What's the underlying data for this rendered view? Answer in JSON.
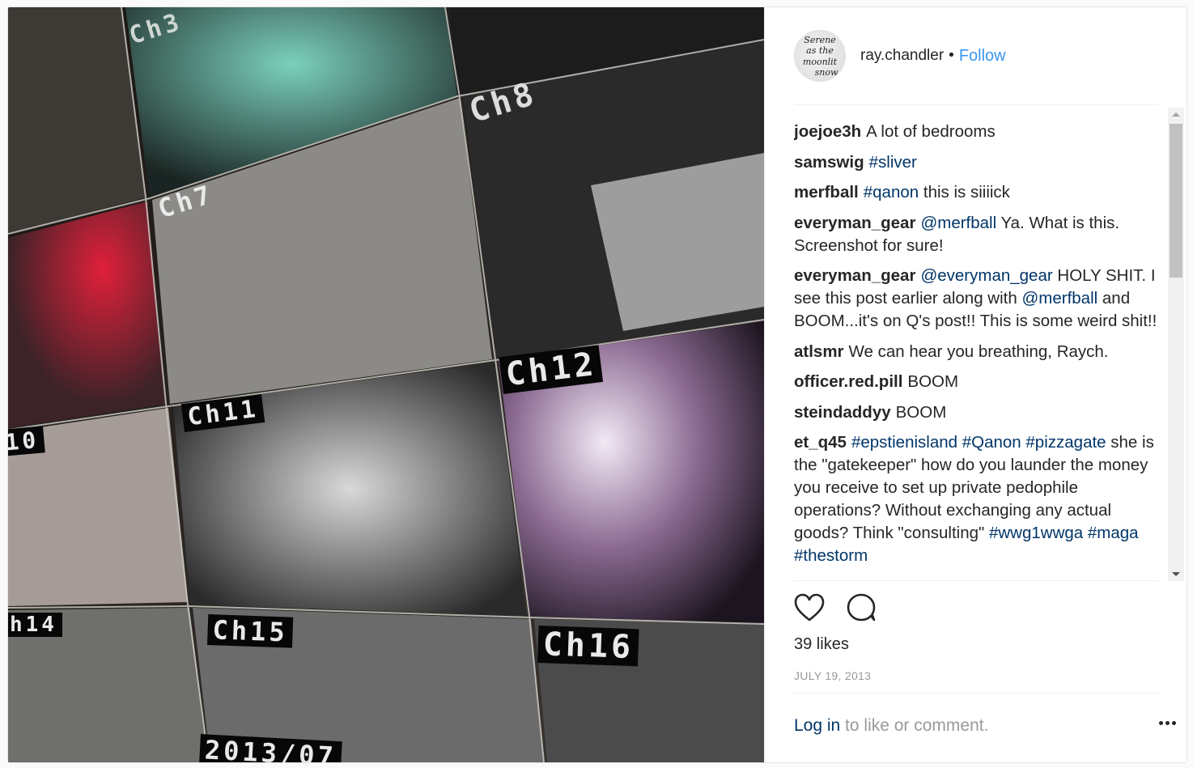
{
  "post": {
    "photo": {
      "description": "Photo of a CCTV multi-camera monitor wall",
      "channel_labels": [
        "Ch3",
        "Ch7",
        "Ch8",
        "10",
        "Ch11",
        "Ch12",
        "h14",
        "Ch15",
        "Ch16",
        "2013/07"
      ]
    },
    "header": {
      "avatar_text": [
        "Serene",
        "as the",
        "moonlit",
        "snow"
      ],
      "username": "ray.chandler",
      "separator": "•",
      "follow_label": "Follow"
    },
    "comments": [
      {
        "user": "joejoe3h",
        "parts": [
          {
            "type": "text",
            "value": "A lot of bedrooms"
          }
        ]
      },
      {
        "user": "samswig",
        "parts": [
          {
            "type": "tag",
            "value": "#sliver"
          }
        ]
      },
      {
        "user": "merfball",
        "parts": [
          {
            "type": "tag",
            "value": "#qanon"
          },
          {
            "type": "text",
            "value": " this is siiiick"
          }
        ]
      },
      {
        "user": "everyman_gear",
        "parts": [
          {
            "type": "tag",
            "value": "@merfball"
          },
          {
            "type": "text",
            "value": " Ya. What is this. Screenshot for sure!"
          }
        ]
      },
      {
        "user": "everyman_gear",
        "parts": [
          {
            "type": "tag",
            "value": "@everyman_gear"
          },
          {
            "type": "text",
            "value": " HOLY SHIT. I see this post earlier along with "
          },
          {
            "type": "tag",
            "value": "@merfball"
          },
          {
            "type": "text",
            "value": " and BOOM...it's on Q's post!! This is some weird shit!!"
          }
        ]
      },
      {
        "user": "atlsmr",
        "parts": [
          {
            "type": "text",
            "value": "We can hear you breathing, Raych."
          }
        ]
      },
      {
        "user": "officer.red.pill",
        "parts": [
          {
            "type": "text",
            "value": "BOOM"
          }
        ]
      },
      {
        "user": "steindaddyy",
        "parts": [
          {
            "type": "text",
            "value": "BOOM"
          }
        ]
      },
      {
        "user": "et_q45",
        "parts": [
          {
            "type": "tag",
            "value": "#epstienisland"
          },
          {
            "type": "text",
            "value": " "
          },
          {
            "type": "tag",
            "value": "#Qanon"
          },
          {
            "type": "text",
            "value": " "
          },
          {
            "type": "tag",
            "value": "#pizzagate"
          },
          {
            "type": "text",
            "value": " she is the \"gatekeeper\" how do you launder the money you receive to set up private pedophile operations? Without exchanging any actual goods? Think \"consulting\" "
          },
          {
            "type": "tag",
            "value": "#wwg1wwga"
          },
          {
            "type": "text",
            "value": " "
          },
          {
            "type": "tag",
            "value": "#maga"
          },
          {
            "type": "text",
            "value": " "
          },
          {
            "type": "tag",
            "value": "#thestorm"
          }
        ]
      }
    ],
    "actions": {
      "like_icon": "heart-outline-icon",
      "comment_icon": "speech-bubble-icon"
    },
    "likes": "39 likes",
    "date": "JULY 19, 2013",
    "footer": {
      "login_label": "Log in",
      "login_suffix": " to like or comment.",
      "more_icon": "ellipsis-icon"
    }
  },
  "colors": {
    "follow": "#3897f0",
    "tag": "#003569",
    "text": "#262626",
    "muted": "#999999"
  }
}
